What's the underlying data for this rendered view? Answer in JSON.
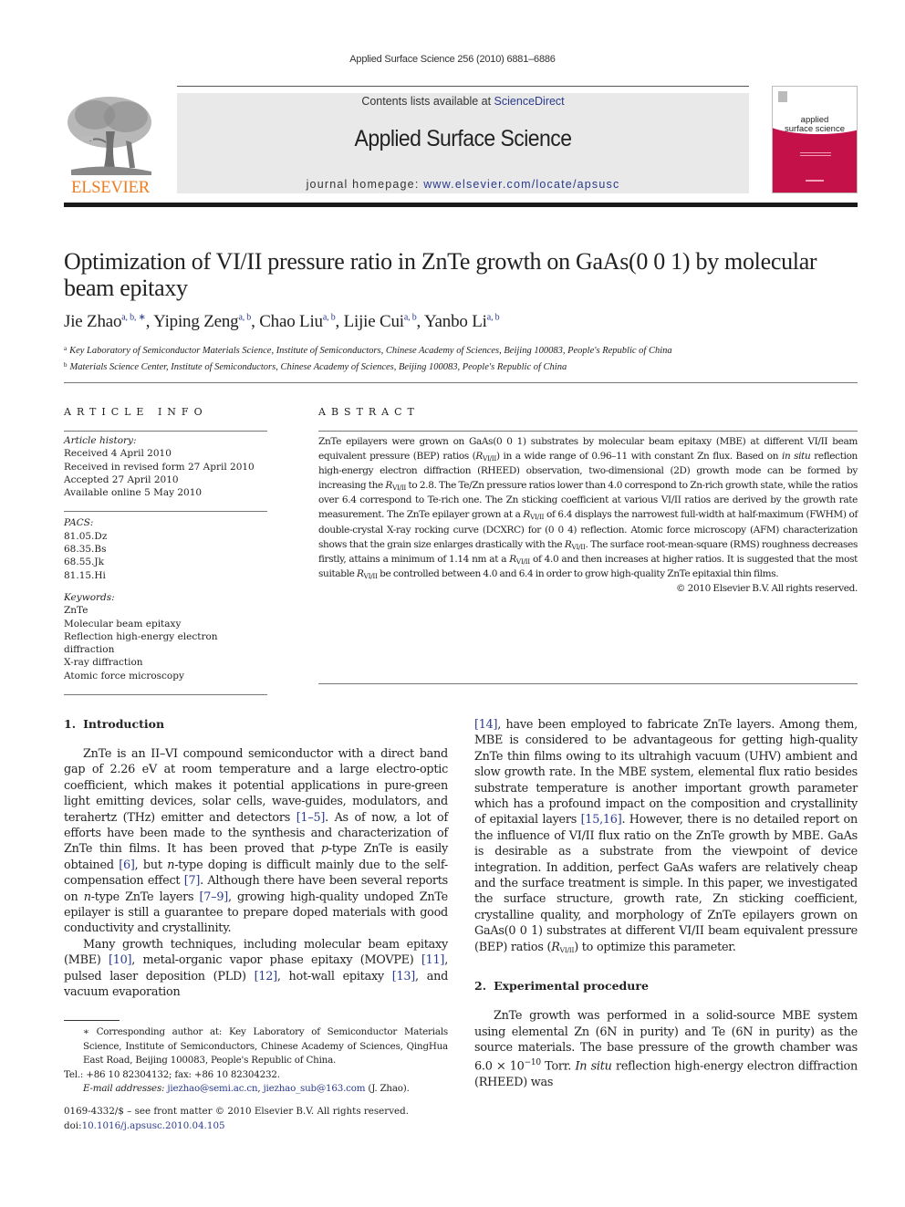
{
  "citation": "Applied Surface Science 256 (2010) 6881–6886",
  "header": {
    "contents_prefix": "Contents lists available at ",
    "contents_link": "ScienceDirect",
    "journal_name": "Applied Surface Science",
    "homepage_prefix": "journal homepage: ",
    "homepage_link": "www.elsevier.com/locate/apsusc",
    "publisher_word": "ELSEVIER",
    "cover_title_line1": "applied",
    "cover_title_line2": "surface science",
    "colors": {
      "publisher_orange": "#f07c20",
      "cover_magenta": "#c4114a",
      "link_blue": "#2a3a8c",
      "header_gray": "#e9e9e9"
    }
  },
  "article": {
    "title": "Optimization of VI/II pressure ratio in ZnTe growth on GaAs(0 0 1) by molecular beam epitaxy",
    "authors": [
      {
        "name": "Jie Zhao",
        "sup": "a, b, ∗"
      },
      {
        "name": "Yiping Zeng",
        "sup": "a, b"
      },
      {
        "name": "Chao Liu",
        "sup": "a, b"
      },
      {
        "name": "Lijie Cui",
        "sup": "a, b"
      },
      {
        "name": "Yanbo Li",
        "sup": "a, b"
      }
    ],
    "affiliations": [
      {
        "mark": "a",
        "text": "Key Laboratory of Semiconductor Materials Science, Institute of Semiconductors, Chinese Academy of Sciences, Beijing 100083, People's Republic of China"
      },
      {
        "mark": "b",
        "text": "Materials Science Center, Institute of Semiconductors, Chinese Academy of Sciences, Beijing 100083, People's Republic of China"
      }
    ]
  },
  "article_info": {
    "heading": "ARTICLE INFO",
    "history_label": "Article history:",
    "history": [
      "Received 4 April 2010",
      "Received in revised form 27 April 2010",
      "Accepted 27 April 2010",
      "Available online 5 May 2010"
    ],
    "pacs_label": "PACS:",
    "pacs": [
      "81.05.Dz",
      "68.35.Bs",
      "68.55.Jk",
      "81.15.Hi"
    ],
    "keywords_label": "Keywords:",
    "keywords": [
      "ZnTe",
      "Molecular beam epitaxy",
      "Reflection high-energy electron diffraction",
      "X-ray diffraction",
      "Atomic force microscopy"
    ]
  },
  "abstract": {
    "heading": "ABSTRACT",
    "r_symbol": "R",
    "r_sub": "VI/II",
    "s1": "ZnTe epilayers were grown on GaAs(0 0 1) substrates by molecular beam epitaxy (MBE) at different VI/II beam equivalent pressure (BEP) ratios (",
    "s2": ") in a wide range of 0.96–11 with constant Zn flux. Based on ",
    "s2_it": "in situ",
    "s3": " reflection high-energy electron diffraction (RHEED) observation, two-dimensional (2D) growth mode can be formed by increasing the ",
    "s4": " to 2.8. The Te/Zn pressure ratios lower than 4.0 correspond to Zn-rich growth state, while the ratios over 6.4 correspond to Te-rich one. The Zn sticking coefficient at various VI/II ratios are derived by the growth rate measurement. The ZnTe epilayer grown at a ",
    "s5": " of 6.4 displays the narrowest full-width at half-maximum (FWHM) of double-crystal X-ray rocking curve (DCXRC) for (0 0 4) reflection. Atomic force microscopy (AFM) characterization shows that the grain size enlarges drastically with the ",
    "s6": ". The surface root-mean-square (RMS) roughness decreases firstly, attains a minimum of 1.14 nm at a ",
    "s7": " of 4.0 and then increases at higher ratios. It is suggested that the most suitable ",
    "s8": " be controlled between 4.0 and 6.4 in order to grow high-quality ZnTe epitaxial thin films.",
    "copyright": "© 2010 Elsevier B.V. All rights reserved."
  },
  "intro": {
    "number": "1.",
    "title": "Introduction",
    "p1_a": "ZnTe is an II–VI compound semiconductor with a direct band gap of 2.26 eV at room temperature and a large electro-optic coefficient, which makes it potential applications in pure-green light emitting devices, solar cells, wave-guides, modulators, and terahertz (THz) emitter and detectors ",
    "ref_1_5": "[1–5]",
    "p1_b": ". As of now, a lot of efforts have been made to the synthesis and characterization of ZnTe thin films. It has been proved that ",
    "p_type": "p",
    "p1_c": "-type ZnTe is easily obtained ",
    "ref_6": "[6]",
    "p1_d": ", but ",
    "n_type": "n",
    "p1_e": "-type doping is difficult mainly due to the self-compensation effect ",
    "ref_7": "[7]",
    "p1_f": ". Although there have been several reports on ",
    "p1_g": "-type ZnTe layers ",
    "ref_7_9": "[7–9]",
    "p1_h": ", growing high-quality undoped ZnTe epilayer is still a guarantee to prepare doped materials with good conductivity and crystallinity.",
    "p2_a": "Many growth techniques, including molecular beam epitaxy (MBE) ",
    "ref_10": "[10]",
    "p2_b": ", metal-organic vapor phase epitaxy (MOVPE) ",
    "ref_11": "[11]",
    "p2_c": ", pulsed laser deposition (PLD) ",
    "ref_12": "[12]",
    "p2_d": ", hot-wall epitaxy ",
    "ref_13": "[13]",
    "p2_e": ", and vacuum evaporation ",
    "ref_14": "[14]",
    "p2_f": ", have been employed to fabricate ZnTe layers. Among them, MBE is considered to be advantageous for getting high-quality ZnTe thin films owing to its ultrahigh vacuum (UHV) ambient and slow growth rate. In the MBE system, elemental flux ratio besides substrate temperature is another important growth parameter which has a profound impact on the composition and crystallinity of epitaxial layers ",
    "ref_15_16": "[15,16]",
    "p2_g": ". However, there is no detailed report on the influence of VI/II flux ratio on the ZnTe growth by MBE. GaAs is desirable as a substrate from the viewpoint of device integration. In addition, perfect GaAs wafers are relatively cheap and the surface treatment is simple. In this paper, we investigated the surface structure, growth rate, Zn sticking coefficient, crystalline quality, and morphology of ZnTe epilayers grown on GaAs(0 0 1) substrates at different VI/II beam equivalent pressure (BEP) ratios (",
    "p2_h": ") to optimize this parameter."
  },
  "experimental": {
    "number": "2.",
    "title": "Experimental procedure",
    "p1_a": "ZnTe growth was performed in a solid-source MBE system using elemental Zn (6N in purity) and Te (6N in purity) as the source materials. The base pressure of the growth chamber was 6.0 × 10",
    "exp": "−10",
    "p1_b": " Torr. ",
    "in_situ": "In situ",
    "p1_c": " reflection high-energy electron diffraction (RHEED) was"
  },
  "footnotes": {
    "star_text": "∗ Corresponding author at: Key Laboratory of Semiconductor Materials Science, Institute of Semiconductors, Chinese Academy of Sciences, QingHua East Road, Beijing 100083, People's Republic of China.",
    "tel": "Tel.: +86 10 82304132; fax: +86 10 82304232.",
    "email_label": "E-mail addresses:",
    "email1": "jiezhao@semi.ac.cn",
    "email_sep": ", ",
    "email2": "jiezhao_sub@163.com",
    "email_suffix": " (J. Zhao).",
    "issn": "0169-4332/$ – see front matter © 2010 Elsevier B.V. All rights reserved.",
    "doi_prefix": "doi:",
    "doi": "10.1016/j.apsusc.2010.04.105"
  }
}
